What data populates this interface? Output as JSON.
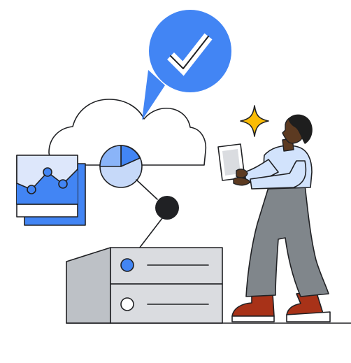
{
  "illustration": {
    "icons": [
      "check-bubble-icon",
      "cloud-icon",
      "line-chart-icon",
      "pie-chart-icon",
      "server-rack-icon",
      "sparkle-icon",
      "person-with-tablet-icon"
    ],
    "colors": {
      "accent_blue": "#4285F4",
      "light_blue": "#C6D9F9",
      "pale_blue": "#DDE7FB",
      "sparkle_yellow": "#FBBC04",
      "server_gray": "#DADCE0",
      "server_dark_gray": "#BDC1C6",
      "pants_gray": "#80868B",
      "shoe_red": "#A83218",
      "skin": "#5C3A21",
      "hair": "#1E1E1E",
      "outline": "#202124"
    }
  }
}
